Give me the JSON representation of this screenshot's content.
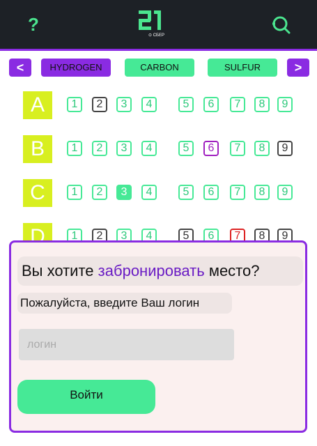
{
  "header": {
    "help_icon_glyph": "?",
    "logo_text": "21",
    "logo_sub": "⊙ СБЕР",
    "icons": [
      "question-icon",
      "school-21-logo",
      "search-icon"
    ]
  },
  "tabs": [
    {
      "label": "<",
      "kind": "arrow"
    },
    {
      "label": "HYDROGEN",
      "kind": "purple"
    },
    {
      "label": "CARBON",
      "kind": "green"
    },
    {
      "label": "SULFUR",
      "kind": "green"
    },
    {
      "label": ">",
      "kind": "arrow"
    }
  ],
  "rows": [
    {
      "label": "A",
      "seats": [
        {
          "n": "1",
          "s": "free"
        },
        {
          "n": "2",
          "s": "gray"
        },
        {
          "n": "3",
          "s": "free"
        },
        {
          "n": "4",
          "s": "free"
        },
        {
          "n": "5",
          "s": "free"
        },
        {
          "n": "6",
          "s": "free"
        },
        {
          "n": "7",
          "s": "free"
        },
        {
          "n": "8",
          "s": "free"
        },
        {
          "n": "9",
          "s": "free"
        }
      ]
    },
    {
      "label": "B",
      "seats": [
        {
          "n": "1",
          "s": "free"
        },
        {
          "n": "2",
          "s": "free"
        },
        {
          "n": "3",
          "s": "free"
        },
        {
          "n": "4",
          "s": "free"
        },
        {
          "n": "5",
          "s": "free"
        },
        {
          "n": "6",
          "s": "magenta"
        },
        {
          "n": "7",
          "s": "free"
        },
        {
          "n": "8",
          "s": "free"
        },
        {
          "n": "9",
          "s": "gray"
        }
      ]
    },
    {
      "label": "C",
      "seats": [
        {
          "n": "1",
          "s": "free"
        },
        {
          "n": "2",
          "s": "free"
        },
        {
          "n": "3",
          "s": "filled"
        },
        {
          "n": "4",
          "s": "free"
        },
        {
          "n": "5",
          "s": "free"
        },
        {
          "n": "6",
          "s": "free"
        },
        {
          "n": "7",
          "s": "free"
        },
        {
          "n": "8",
          "s": "free"
        },
        {
          "n": "9",
          "s": "free"
        }
      ]
    },
    {
      "label": "D",
      "seats": [
        {
          "n": "1",
          "s": "free"
        },
        {
          "n": "2",
          "s": "gray"
        },
        {
          "n": "3",
          "s": "free"
        },
        {
          "n": "4",
          "s": "free"
        },
        {
          "n": "5",
          "s": "gray"
        },
        {
          "n": "6",
          "s": "free"
        },
        {
          "n": "7",
          "s": "red"
        },
        {
          "n": "8",
          "s": "gray"
        },
        {
          "n": "9",
          "s": "gray"
        }
      ]
    }
  ],
  "modal": {
    "question_prefix": "Вы хотите ",
    "question_accent": "забронировать",
    "question_suffix": " место?",
    "prompt": "Пожалуйста, введите Ваш логин",
    "login_placeholder": "логин",
    "login_value": "",
    "submit_label": "Войти"
  },
  "colors": {
    "accent": "#8a2be2",
    "green": "#46e996",
    "yellow": "#d8ef20",
    "dark": "#1d2126"
  }
}
